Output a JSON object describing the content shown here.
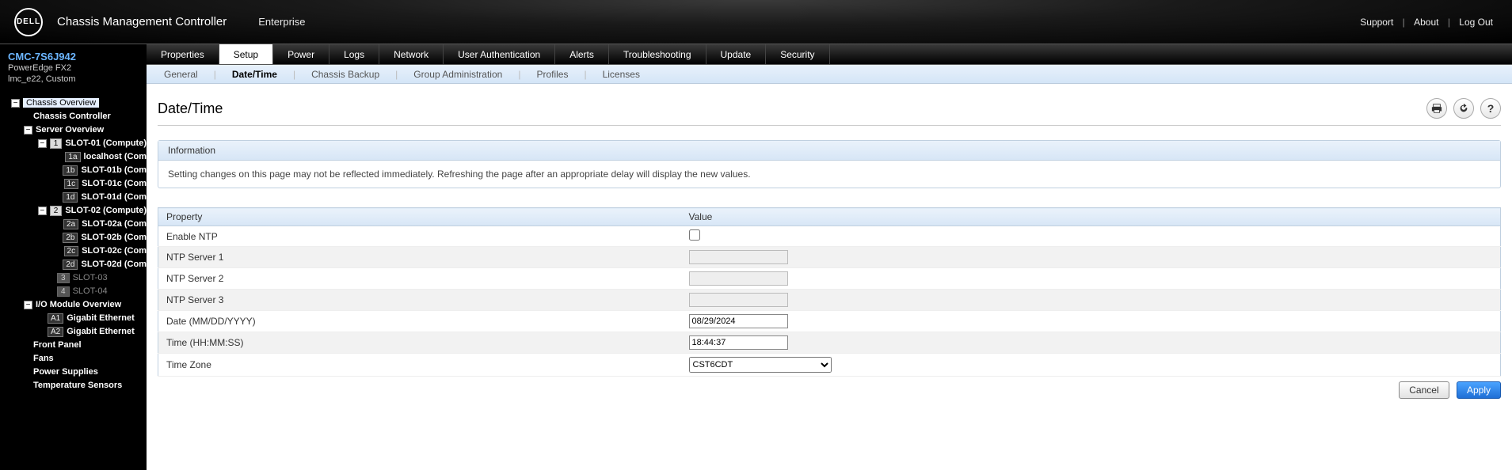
{
  "topbar": {
    "product": "Chassis Management Controller",
    "context": "Enterprise",
    "logo_text": "DELL",
    "links": {
      "support": "Support",
      "about": "About",
      "logout": "Log Out"
    }
  },
  "sidebar": {
    "cmc_id": "CMC-7S6J942",
    "model": "PowerEdge FX2",
    "custom": "lmc_e22, Custom",
    "tree": {
      "chassis_overview": "Chassis Overview",
      "chassis_controller": "Chassis Controller",
      "server_overview": "Server Overview",
      "slot01": "SLOT-01 (Compute)",
      "slot01a": "localhost (Com",
      "slot01b": "SLOT-01b (Com",
      "slot01c": "SLOT-01c (Com",
      "slot01d": "SLOT-01d (Com",
      "slot02": "SLOT-02 (Compute)",
      "slot02a": "SLOT-02a (Com",
      "slot02b": "SLOT-02b (Com",
      "slot02c": "SLOT-02c (Com",
      "slot02d": "SLOT-02d (Com",
      "slot03": "SLOT-03",
      "slot04": "SLOT-04",
      "io_overview": "I/O Module Overview",
      "io_a1": "Gigabit Ethernet",
      "io_a2": "Gigabit Ethernet",
      "front_panel": "Front Panel",
      "fans": "Fans",
      "power_supplies": "Power Supplies",
      "temp_sensors": "Temperature Sensors"
    },
    "badges": {
      "n1": "1",
      "n2": "2",
      "n3": "3",
      "n4": "4",
      "a1": "1a",
      "b1": "1b",
      "c1": "1c",
      "d1": "1d",
      "a2": "2a",
      "b2": "2b",
      "c2": "2c",
      "d2": "2d",
      "A1": "A1",
      "A2": "A2"
    }
  },
  "tabs1": {
    "properties": "Properties",
    "setup": "Setup",
    "power": "Power",
    "logs": "Logs",
    "network": "Network",
    "user_auth": "User Authentication",
    "alerts": "Alerts",
    "troubleshooting": "Troubleshooting",
    "update": "Update",
    "security": "Security"
  },
  "tabs2": {
    "general": "General",
    "datetime": "Date/Time",
    "chassis_backup": "Chassis Backup",
    "group_admin": "Group Administration",
    "profiles": "Profiles",
    "licenses": "Licenses"
  },
  "page": {
    "heading": "Date/Time",
    "info_title": "Information",
    "info_text": "Setting changes on this page may not be reflected immediately. Refreshing the page after an appropriate delay will display the new values.",
    "col_property": "Property",
    "col_value": "Value",
    "rows": {
      "enable_ntp": "Enable NTP",
      "ntp1": "NTP Server 1",
      "ntp2": "NTP Server 2",
      "ntp3": "NTP Server 3",
      "date": "Date (MM/DD/YYYY)",
      "time": "Time (HH:MM:SS)",
      "tz": "Time Zone"
    },
    "values": {
      "enable_ntp": false,
      "ntp1": "",
      "ntp2": "",
      "ntp3": "",
      "date": "08/29/2024",
      "time": "18:44:37",
      "tz": "CST6CDT"
    },
    "buttons": {
      "cancel": "Cancel",
      "apply": "Apply"
    }
  }
}
